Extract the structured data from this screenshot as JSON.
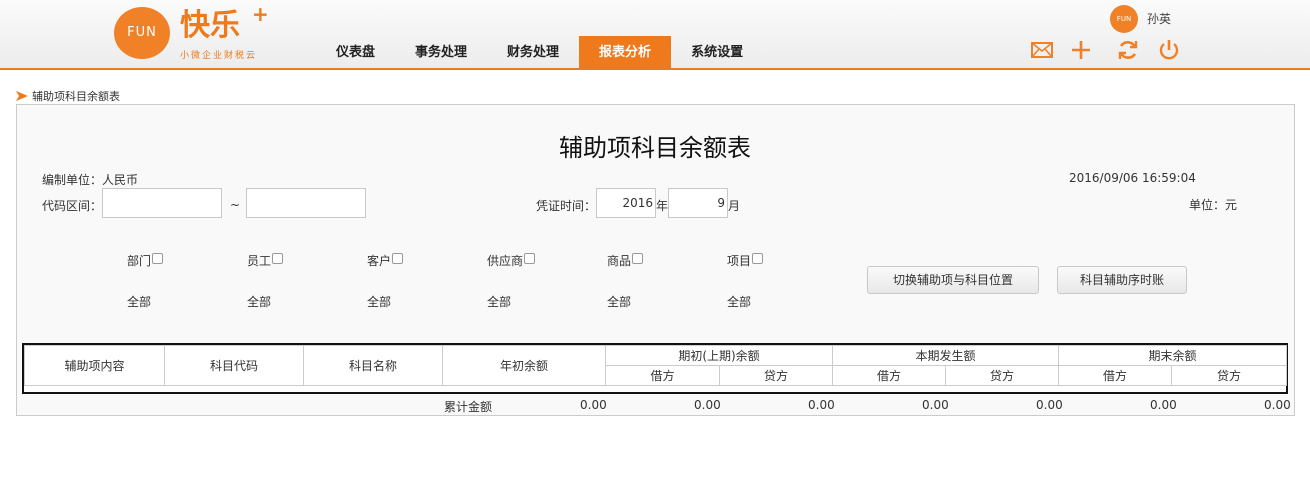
{
  "brand": {
    "logo_circle_text": "FUN",
    "name": "快乐",
    "plus": "+",
    "tagline": "小微企业财税云"
  },
  "nav": {
    "items": [
      {
        "label": "仪表盘"
      },
      {
        "label": "事务处理"
      },
      {
        "label": "财务处理"
      },
      {
        "label": "报表分析"
      },
      {
        "label": "系统设置"
      }
    ],
    "active_index": 3
  },
  "user": {
    "avatar_text": "FUN",
    "name": "孙英"
  },
  "header_icons": [
    "mail-icon",
    "plus-icon",
    "refresh-icon",
    "power-icon"
  ],
  "breadcrumb": {
    "label": "辅助项科目余额表"
  },
  "report": {
    "title": "辅助项科目余额表",
    "unit_label": "编制单位：人民币",
    "timestamp": "2016/09/06 16:59:04",
    "code_range_label": "代码区间：",
    "code_from": "",
    "code_to": "",
    "tilde": "~",
    "voucher_time_label": "凭证时间：",
    "year": "2016",
    "year_suffix": "年",
    "month": "9",
    "month_suffix": "月",
    "currency_unit": "单位：元"
  },
  "filters": [
    {
      "label": "部门",
      "value": "全部"
    },
    {
      "label": "员工",
      "value": "全部"
    },
    {
      "label": "客户",
      "value": "全部"
    },
    {
      "label": "供应商",
      "value": "全部"
    },
    {
      "label": "商品",
      "value": "全部"
    },
    {
      "label": "项目",
      "value": "全部"
    }
  ],
  "buttons": {
    "switch": "切换辅助项与科目位置",
    "ledger": "科目辅助序时账"
  },
  "table": {
    "headers": [
      "辅助项内容",
      "科目代码",
      "科目名称",
      "年初余额"
    ],
    "groups": [
      "期初(上期)余额",
      "本期发生额",
      "期末余额"
    ],
    "debit": "借方",
    "credit": "贷方"
  },
  "footer": {
    "label": "累计金额",
    "values": [
      "0.00",
      "0.00",
      "0.00",
      "0.00",
      "0.00",
      "0.00",
      "0.00"
    ]
  },
  "colors": {
    "accent": "#ef7a1d"
  }
}
